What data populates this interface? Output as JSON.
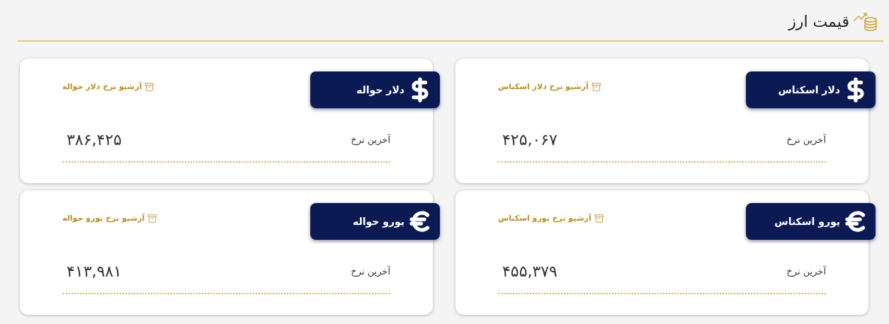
{
  "header": {
    "title": "قیمت ارز"
  },
  "cards": [
    {
      "kind": "dollar",
      "name": "دلار اسکناس",
      "archive_link": "آرشیو نرخ دلار اسکناس",
      "label": "آخرین نرخ",
      "value": "۴۲۵,۰۶۷"
    },
    {
      "kind": "dollar",
      "name": "دلار حواله",
      "archive_link": "آرشیو نرخ دلار حواله",
      "label": "آخرین نرخ",
      "value": "۳۸۶,۴۲۵"
    },
    {
      "kind": "euro",
      "name": "یورو اسکناس",
      "archive_link": "آرشیو نرخ یورو اسکناس",
      "label": "آخرین نرخ",
      "value": "۴۵۵,۳۷۹"
    },
    {
      "kind": "euro",
      "name": "یورو حواله",
      "archive_link": "آرشیو نرخ یورو حواله",
      "label": "آخرین نرخ",
      "value": "۴۱۳,۹۸۱"
    }
  ]
}
